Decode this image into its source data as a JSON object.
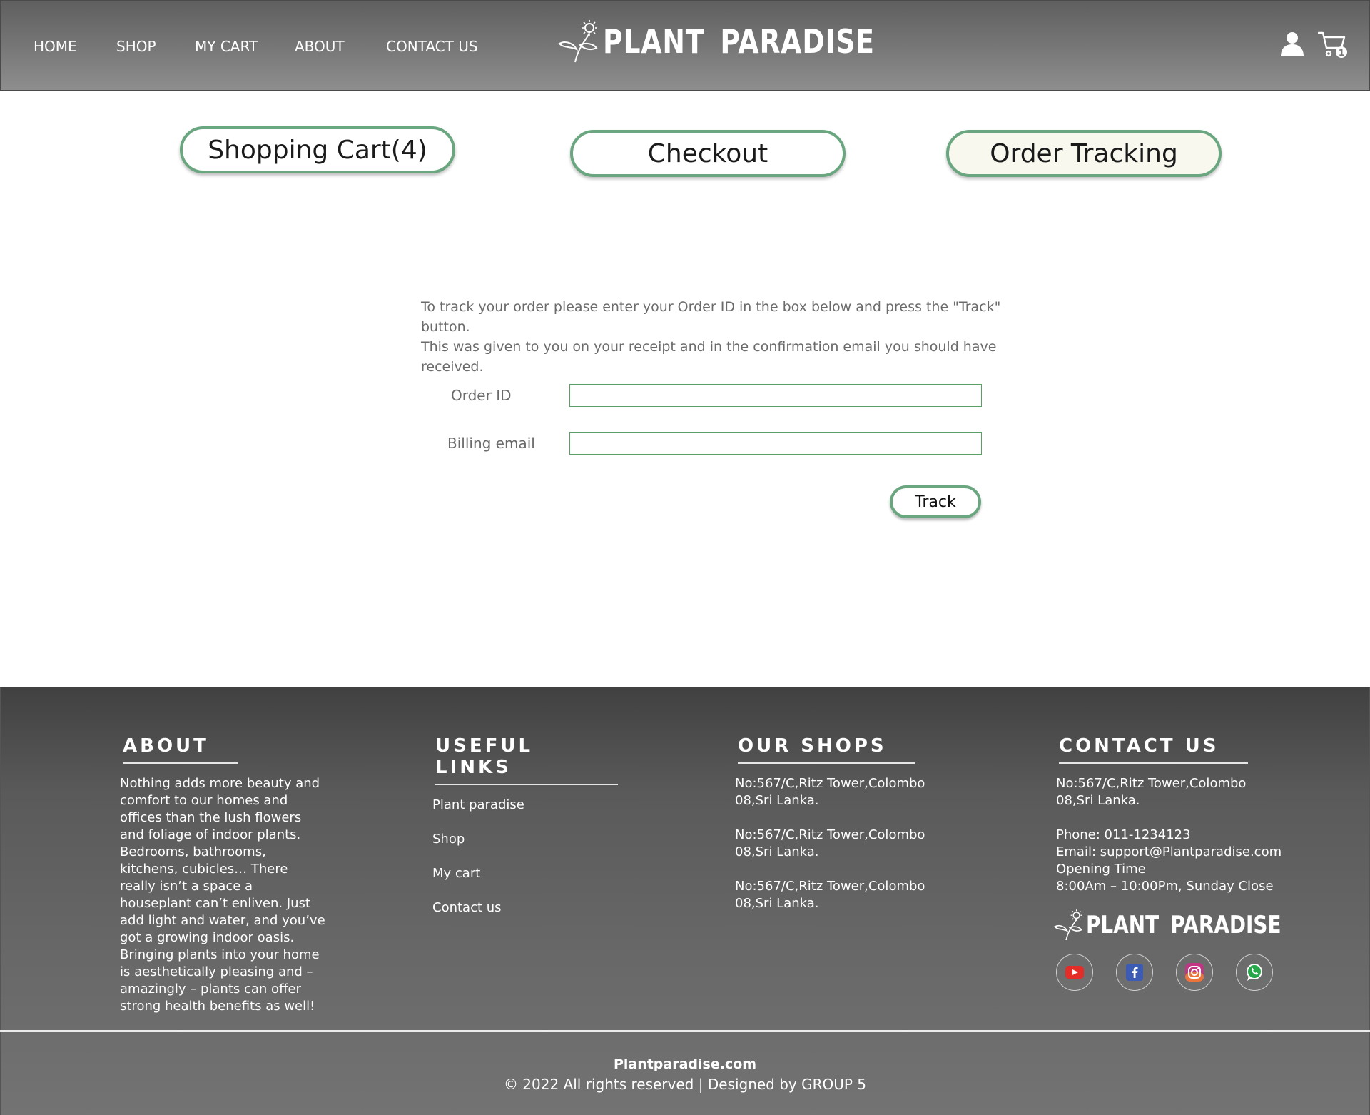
{
  "header": {
    "nav": [
      "HOME",
      "SHOP",
      "MY CART",
      "ABOUT",
      "CONTACT US"
    ],
    "brand": "PLANT PARADISE",
    "cart_count": "1"
  },
  "steps": {
    "cart": "Shopping Cart(4)",
    "checkout": "Checkout",
    "tracking": "Order Tracking"
  },
  "tracking_form": {
    "intro_line1": "To track your order please enter your Order ID in the box below and press the \"Track\" button.",
    "intro_line2": "This was given to you on your receipt and in the confirmation email you should have received.",
    "order_label": "Order ID",
    "email_label": "Billing email",
    "order_value": "",
    "email_value": "",
    "track_label": "Track"
  },
  "footer": {
    "about": {
      "title": "ABOUT",
      "text": "Nothing adds more beauty and comfort to our homes and offices than the lush flowers and foliage of indoor plants. Bedrooms, bathrooms, kitchens, cubicles… There really isn’t a space a houseplant can’t enliven. Just add light and water, and you’ve got a growing indoor oasis. Bringing plants into your home is aesthetically pleasing and – amazingly – plants can offer strong health benefits as well!"
    },
    "links": {
      "title": "USEFUL LINKS",
      "items": [
        "Plant paradise",
        "Shop",
        "My cart",
        "Contact us"
      ]
    },
    "shops": {
      "title": "OUR SHOPS",
      "items": [
        "No:567/C,Ritz Tower,Colombo 08,Sri Lanka.",
        "No:567/C,Ritz Tower,Colombo 08,Sri Lanka.",
        "No:567/C,Ritz Tower,Colombo 08,Sri Lanka."
      ]
    },
    "contact": {
      "title": "CONTACT US",
      "address": "No:567/C,Ritz Tower,Colombo 08,Sri Lanka.",
      "phone": "Phone: 011-1234123",
      "email": "Email: support@Plantparadise.com",
      "opening_label": "Opening Time",
      "hours": "8:00Am – 10:00Pm, Sunday Close"
    },
    "brand": "PLANT PARADISE",
    "socials": [
      "youtube-icon",
      "facebook-icon",
      "instagram-icon",
      "whatsapp-icon"
    ],
    "site": "Plantparadise.com",
    "copyright": "© 2022 All rights reserved | Designed by GROUP 5"
  },
  "colors": {
    "accent_green": "#6aa67f",
    "header_gray": "#787878",
    "footer_gray": "#5a5a5a"
  }
}
